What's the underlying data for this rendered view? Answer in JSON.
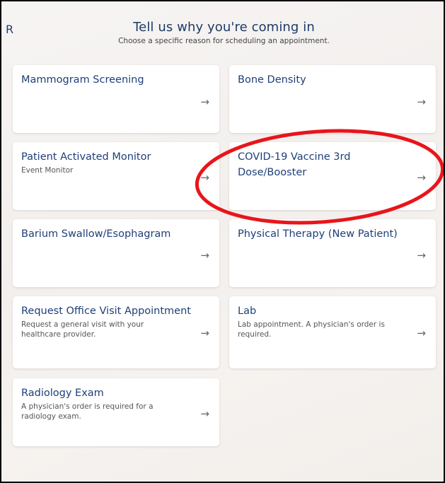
{
  "header": {
    "title": "Tell us why you're coming in",
    "subtitle": "Choose a specific reason for scheduling an appointment.",
    "cut_letter": "R"
  },
  "cards": [
    {
      "name": "Mammogram Screening",
      "desc": "",
      "arrow_icon": "arrow-right-icon",
      "arrow": "→"
    },
    {
      "name": "Bone Density",
      "desc": "",
      "arrow_icon": "arrow-right-icon",
      "arrow": "→"
    },
    {
      "name": "Patient Activated Monitor",
      "desc": "Event Monitor",
      "arrow_icon": "arrow-right-icon",
      "arrow": "→"
    },
    {
      "name": "COVID-19 Vaccine 3rd Dose/Booster",
      "desc": "",
      "arrow_icon": "arrow-right-icon",
      "arrow": "→"
    },
    {
      "name": "Barium Swallow/Esophagram",
      "desc": "",
      "arrow_icon": "arrow-right-icon",
      "arrow": "→"
    },
    {
      "name": "Physical Therapy (New Patient)",
      "desc": "",
      "arrow_icon": "arrow-right-icon",
      "arrow": "→"
    },
    {
      "name": "Request Office Visit Appointment",
      "desc": "Request a general visit with your healthcare provider.",
      "arrow_icon": "arrow-right-icon",
      "arrow": "→"
    },
    {
      "name": "Lab",
      "desc": "Lab appointment. A physician's order is required.",
      "arrow_icon": "arrow-right-icon",
      "arrow": "→"
    },
    {
      "name": "Radiology Exam",
      "desc": "A physician's order is required for a radiology exam.",
      "arrow_icon": "arrow-right-icon",
      "arrow": "→"
    }
  ],
  "annotation": {
    "color": "#e8151b",
    "shape": "ellipse",
    "target": "COVID-19 Vaccine 3rd Dose/Booster"
  }
}
